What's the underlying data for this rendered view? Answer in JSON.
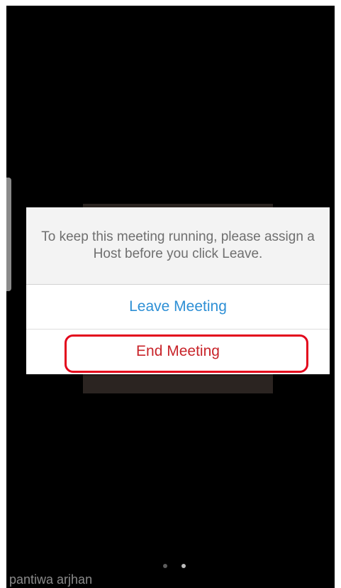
{
  "dialog": {
    "message": "To keep this meeting running, please assign a Host before you click Leave.",
    "leave_label": "Leave Meeting",
    "end_label": "End Meeting"
  },
  "participant": {
    "name": "pantiwa arjhan"
  },
  "pagination": {
    "page_count": 2,
    "active_page": 2
  },
  "colors": {
    "leave_button": "#2d8fd5",
    "end_button": "#c8242a",
    "highlight": "#e3061c"
  }
}
